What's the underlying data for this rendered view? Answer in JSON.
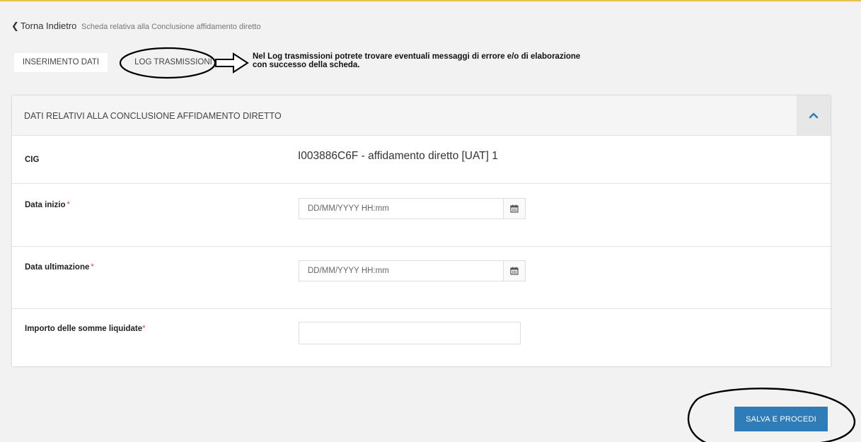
{
  "breadcrumb": {
    "back_icon": "❮",
    "back_label": "Torna Indietro",
    "page_subtitle": "Scheda relativa alla Conclusione affidamento diretto"
  },
  "tabs": [
    {
      "label": "INSERIMENTO DATI",
      "active": true
    },
    {
      "label": "LOG TRASMISSIONI",
      "active": false
    }
  ],
  "annotation_note": "Nel Log trasmissioni potrete trovare eventuali messaggi di errore e/o di elaborazione con successo della scheda.",
  "panel": {
    "title": "DATI RELATIVI ALLA CONCLUSIONE AFFIDAMENTO DIRETTO",
    "collapse_icon": "chevron-up-icon",
    "fields": {
      "cig": {
        "label": "CIG",
        "value": "I003886C6F - affidamento diretto [UAT] 1"
      },
      "data_inizio": {
        "label": "Data inizio",
        "required_mark": "*",
        "value": "",
        "placeholder": "DD/MM/YYYY HH:mm"
      },
      "data_ultimazione": {
        "label": "Data ultimazione",
        "required_mark": "*",
        "value": "",
        "placeholder": "DD/MM/YYYY HH:mm"
      },
      "importo": {
        "label": "Importo delle somme liquidate",
        "required_mark": "*",
        "value": "",
        "placeholder": ""
      }
    }
  },
  "save_button_label": "SALVA E PROCEDI",
  "colors": {
    "accent_top": "#e8c34a",
    "primary_button": "#2e7cb8",
    "chevron": "#2e7cb8",
    "required": "#d9534f"
  }
}
